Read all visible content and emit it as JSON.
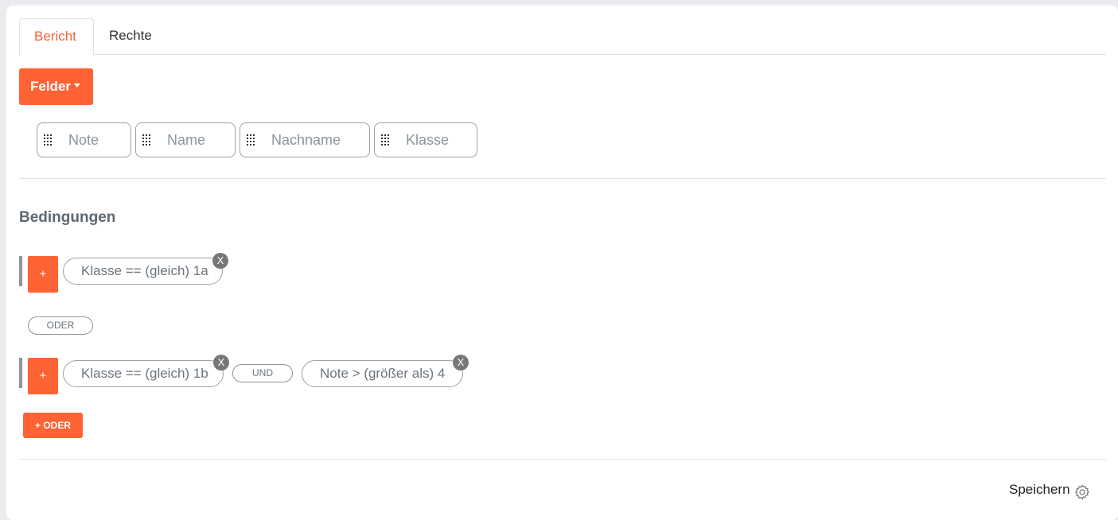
{
  "tabs": [
    {
      "label": "Bericht",
      "active": true
    },
    {
      "label": "Rechte",
      "active": false
    }
  ],
  "fields_button": {
    "label": "Felder",
    "icon": "caret-down-icon"
  },
  "fields": [
    {
      "label": "Note"
    },
    {
      "label": "Name"
    },
    {
      "label": "Nachname"
    },
    {
      "label": "Klasse"
    }
  ],
  "conditions": {
    "heading": "Bedingungen",
    "groups": [
      {
        "add_label": "+",
        "items": [
          {
            "text": "Klasse == (gleich) 1a",
            "remove_label": "X"
          }
        ]
      },
      {
        "add_label": "+",
        "items": [
          {
            "text": "Klasse == (gleich) 1b",
            "remove_label": "X"
          },
          {
            "text": "Note > (größer als) 4",
            "remove_label": "X"
          }
        ],
        "joiner": "UND"
      }
    ],
    "group_separator": "ODER",
    "add_or_label": "+ ODER"
  },
  "footer": {
    "save_label": "Speichern",
    "save_icon": "gear-icon"
  },
  "colors": {
    "accent": "#ff6233",
    "tab_active": "#f4623a",
    "muted": "#8c959d"
  }
}
